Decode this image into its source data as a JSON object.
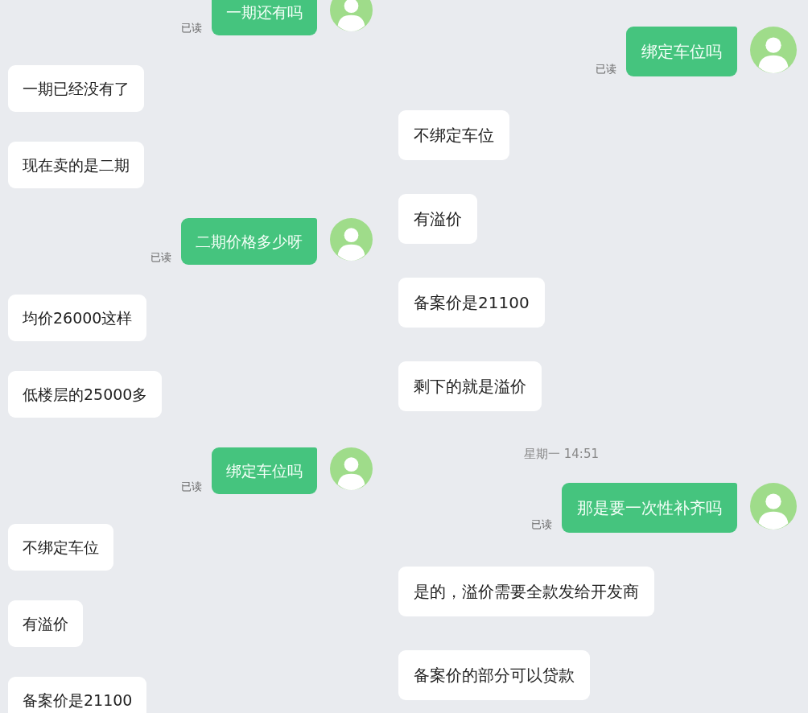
{
  "panels": [
    {
      "messages": [
        {
          "kind": "sent",
          "text": "一期还有吗",
          "read_label": "已读"
        },
        {
          "kind": "received",
          "text": "一期已经没有了"
        },
        {
          "kind": "received",
          "text": "现在卖的是二期"
        },
        {
          "kind": "sent",
          "text": "二期价格多少呀",
          "read_label": "已读"
        },
        {
          "kind": "received",
          "text": "均价26000这样"
        },
        {
          "kind": "received",
          "text": "低楼层的25000多"
        },
        {
          "kind": "sent",
          "text": "绑定车位吗",
          "read_label": "已读"
        },
        {
          "kind": "received",
          "text": "不绑定车位"
        },
        {
          "kind": "received",
          "text": "有溢价"
        },
        {
          "kind": "received",
          "text": "备案价是21100"
        }
      ]
    },
    {
      "messages": [
        {
          "kind": "sent",
          "text": "绑定车位吗",
          "read_label": "已读"
        },
        {
          "kind": "received",
          "text": "不绑定车位"
        },
        {
          "kind": "received",
          "text": "有溢价"
        },
        {
          "kind": "received",
          "text": "备案价是21100"
        },
        {
          "kind": "received",
          "text": "剩下的就是溢价"
        },
        {
          "kind": "time",
          "text": "星期一 14:51"
        },
        {
          "kind": "sent",
          "text": "那是要一次性补齐吗",
          "read_label": "已读"
        },
        {
          "kind": "received",
          "text": "是的，溢价需要全款发给开发商"
        },
        {
          "kind": "received",
          "text": "备案价的部分可以贷款"
        }
      ]
    }
  ]
}
